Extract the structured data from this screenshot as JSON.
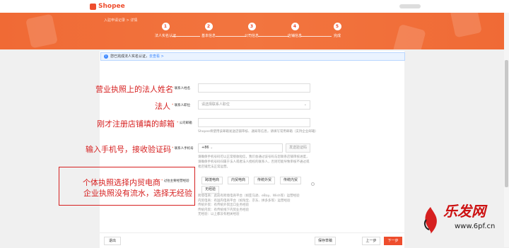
{
  "brand": "Shopee",
  "breadcrumb": "入驻申请记录 > 详情",
  "steps": [
    {
      "num": "1",
      "label": "法人实名认证"
    },
    {
      "num": "2",
      "label": "基本信息"
    },
    {
      "num": "3",
      "label": "公司信息"
    },
    {
      "num": "4",
      "label": "店铺信息"
    },
    {
      "num": "5",
      "label": "完成"
    }
  ],
  "notice": {
    "text": "您已完成法人实名认证，",
    "link": "去查看 >"
  },
  "annotations": {
    "a1": "营业执照上的法人姓名",
    "a2": "法人",
    "a3": "刚才注册店铺填的邮箱",
    "a4": "输入手机号，接收验证码",
    "a5_line1": "个体执照选择内贸电商",
    "a5_line2": "企业执照没有流水，选择无经验"
  },
  "form": {
    "name_label": "联系人姓名",
    "role_label": "联系人职位",
    "role_placeholder": "请选择联系人职位",
    "email_label": "公司邮箱",
    "email_helper": "Shopee将使用该邮箱发送店铺审核、通知等信息，请填写常用邮箱（支持企业邮箱）",
    "phone_label": "联系人手机号",
    "phone_prefix": "+86",
    "phone_btn": "发送验证码",
    "phone_helper_1": "请确保手机号码可以正常接收短信，我们会通过该号码与您联系店铺审核进度，",
    "phone_helper_2": "请确保手机号码归属于法人或者法人授权的联系人，否则可能导致审核不通过或",
    "phone_helper_3": "者店铺无法正常运营。",
    "exp_label": "过往主要经营经验",
    "exp_options": [
      "跨境电商",
      "内贸电商",
      "传统外贸",
      "传统内贸",
      "无经验"
    ],
    "exp_helper": [
      "跨境电商：此前有跨境电商平台（如亚马逊、eBay、Wish等）运营经验",
      "内贸电商：有国内电商平台（如淘宝、京东、拼多多等）运营经验",
      "传统外贸：有传统外贸出口业务经验",
      "传统内贸：有传统线下内贸业务经验",
      "无经验：以上都没有相关经验"
    ]
  },
  "buttons": {
    "exit": "退出",
    "save": "保存草稿",
    "prev": "上一步",
    "next": "下一步"
  },
  "watermark": {
    "name": "乐发网",
    "url": "www.6pf.cn"
  }
}
